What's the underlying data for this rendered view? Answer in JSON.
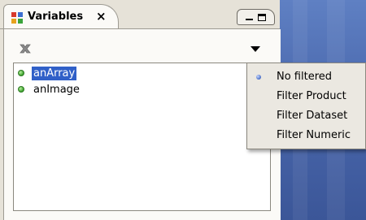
{
  "view": {
    "tab_title": "Variables",
    "tab_close_glyph": "×",
    "tab_icon": "variables-icon",
    "minimize_icon": "minimize-icon",
    "maximize_icon": "maximize-icon"
  },
  "toolbar": {
    "remove_icon": "remove-icon",
    "view_menu_icon": "view-menu-dropdown-icon"
  },
  "variables": [
    {
      "name": "anArray",
      "selected": true
    },
    {
      "name": "anImage",
      "selected": false
    }
  ],
  "filter_menu": {
    "items": [
      {
        "label": "No filtered",
        "checked": true
      },
      {
        "label": "Filter Product",
        "checked": false
      },
      {
        "label": "Filter Dataset",
        "checked": false
      },
      {
        "label": "Filter Numeric",
        "checked": false
      }
    ]
  },
  "colors": {
    "selection": "#3060c8",
    "desktop": "#4a68ad",
    "variable_dot": "#3aa12a"
  }
}
